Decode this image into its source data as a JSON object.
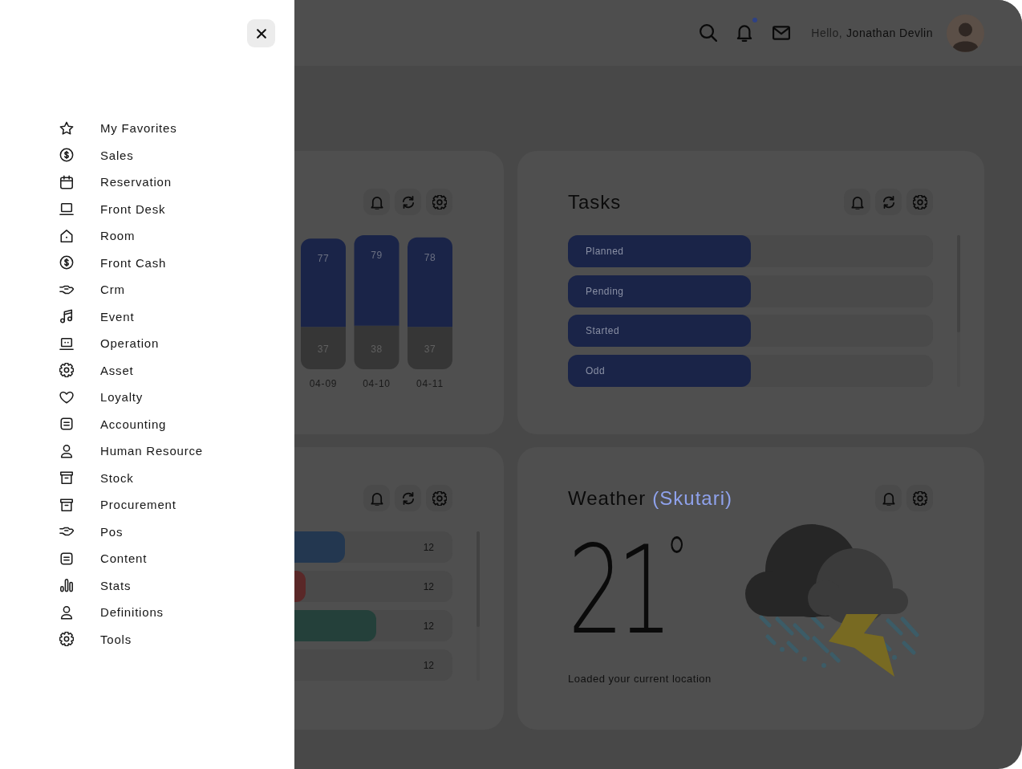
{
  "sidebar": {
    "items": [
      {
        "label": "My Favorites"
      },
      {
        "label": "Sales"
      },
      {
        "label": "Reservation"
      },
      {
        "label": "Front Desk"
      },
      {
        "label": "Room"
      },
      {
        "label": "Front Cash"
      },
      {
        "label": "Crm"
      },
      {
        "label": "Event"
      },
      {
        "label": "Operation"
      },
      {
        "label": "Asset"
      },
      {
        "label": "Loyalty"
      },
      {
        "label": "Accounting"
      },
      {
        "label": "Human Resource"
      },
      {
        "label": "Stock"
      },
      {
        "label": "Procurement"
      },
      {
        "label": "Pos"
      },
      {
        "label": "Content"
      },
      {
        "label": "Stats"
      },
      {
        "label": "Definitions"
      },
      {
        "label": "Tools"
      }
    ]
  },
  "header": {
    "unread_notifications": true,
    "greeting": "Hello,",
    "user_name": "Jonathan Devlin"
  },
  "chart_card": {
    "chart_data": {
      "type": "bar",
      "stacked": true,
      "categories": [
        "04-09",
        "04-10",
        "04-11"
      ],
      "series": [
        {
          "color": "#363636",
          "values": [
            37,
            38,
            37
          ]
        },
        {
          "color": "#1a2448",
          "values": [
            77,
            79,
            78
          ]
        }
      ],
      "data_labels": true
    }
  },
  "tasks_card": {
    "title": "Tasks",
    "rows": [
      {
        "label": "Planned",
        "level": 0.5
      },
      {
        "label": "Pending",
        "level": 0.5
      },
      {
        "label": "Started",
        "level": 0.5
      },
      {
        "label": "Odd",
        "level": 0.5
      }
    ]
  },
  "counts_card": {
    "rows": [
      {
        "value": "12",
        "level": 0.32,
        "color": "#233750"
      },
      {
        "value": "12",
        "level": 0.07,
        "color": "#5a2828"
      },
      {
        "value": "12",
        "level": 0.52,
        "color": "#24403a"
      },
      {
        "value": "12"
      }
    ]
  },
  "weather_card": {
    "title": "Weather",
    "location": "(Skutari)",
    "temperature": "21$^{°}$",
    "status": "Loaded your current location"
  }
}
